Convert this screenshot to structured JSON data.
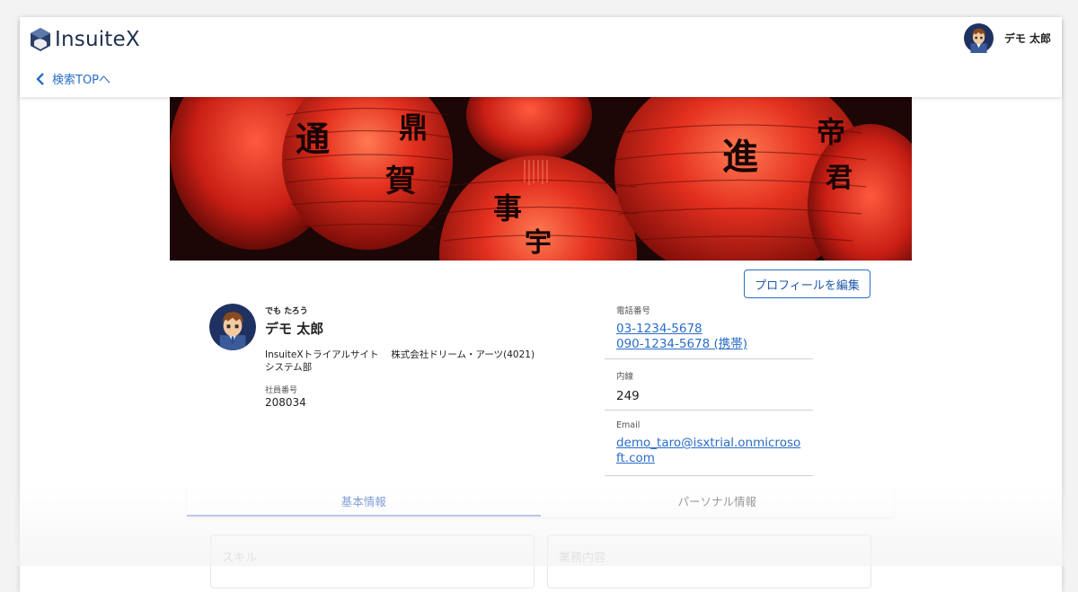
{
  "header": {
    "logo_text": "InsuiteX",
    "back_label": "検索TOPへ",
    "user_name": "デモ 太郎"
  },
  "profile": {
    "edit_button": "プロフィールを編集",
    "kana": "でも たろう",
    "name": "デモ 太郎",
    "company": "InsuiteXトライアルサイト　 株式会社ドリーム・アーツ(4021)",
    "department": "システム部",
    "employee_no_label": "社員番号",
    "employee_no": "208034"
  },
  "contact": {
    "phone_label": "電話番号",
    "phone_1": "03-1234-5678",
    "phone_2": "090-1234-5678 (携帯)",
    "ext_label": "内線",
    "ext_value": "249",
    "email_label": "Email",
    "email_value": "demo_taro@isxtrial.onmicrosoft.com"
  },
  "tabs": [
    {
      "label": "基本情報",
      "active": true
    },
    {
      "label": "パーソナル情報",
      "active": false
    }
  ],
  "sections": {
    "skills": "スキル",
    "duties": "業務内容"
  },
  "banner": {
    "lantern_chars": [
      "通",
      "鼎",
      "賀",
      "進",
      "帝",
      "君",
      "事",
      "宇"
    ]
  },
  "colors": {
    "accent": "#2a6cc7",
    "logo_dark": "#1e2f4f",
    "lantern_red": "#d8241b"
  }
}
